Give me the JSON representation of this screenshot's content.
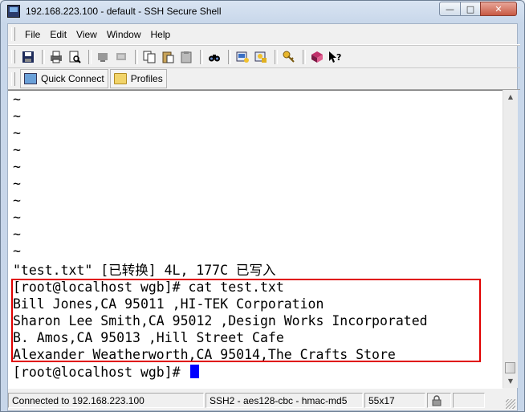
{
  "window": {
    "title": "192.168.223.100 - default - SSH Secure Shell",
    "min_glyph": "—",
    "max_glyph": "□",
    "close_glyph": "✕"
  },
  "menu": [
    "File",
    "Edit",
    "View",
    "Window",
    "Help"
  ],
  "toolbar_icons": [
    "save-icon",
    "print-icon",
    "print-preview-icon",
    "disconnect-icon",
    "connect-icon",
    "copy-icon",
    "paste-icon",
    "paste-icon-2",
    "find-icon",
    "settings-icon",
    "profile-settings-icon",
    "key-icon",
    "help-book-icon",
    "whats-this-icon"
  ],
  "quickbar": {
    "quick_connect": "Quick Connect",
    "profiles": "Profiles"
  },
  "terminal": {
    "tilde_lines": [
      "~",
      "~",
      "~",
      "~",
      "~",
      "~",
      "~",
      "~",
      "~",
      "~"
    ],
    "status_line": "\"test.txt\" [已转换] 4L, 177C 已写入",
    "prompt_cmd": "[root@localhost wgb]# cat test.txt",
    "output": [
      "Bill Jones,CA 95011 ,HI-TEK Corporation",
      "Sharon Lee Smith,CA 95012 ,Design Works Incorporated",
      "B. Amos,CA 95013 ,Hill Street Cafe",
      "Alexander Weatherworth,CA 95014,The Crafts Store"
    ],
    "prompt_final": "[root@localhost wgb]# "
  },
  "status": {
    "connection": "Connected to 192.168.223.100",
    "cipher": "SSH2 - aes128-cbc - hmac-md5",
    "size": "55x17"
  },
  "colors": {
    "highlight_box": "#e00000",
    "cursor": "#0000ff"
  }
}
